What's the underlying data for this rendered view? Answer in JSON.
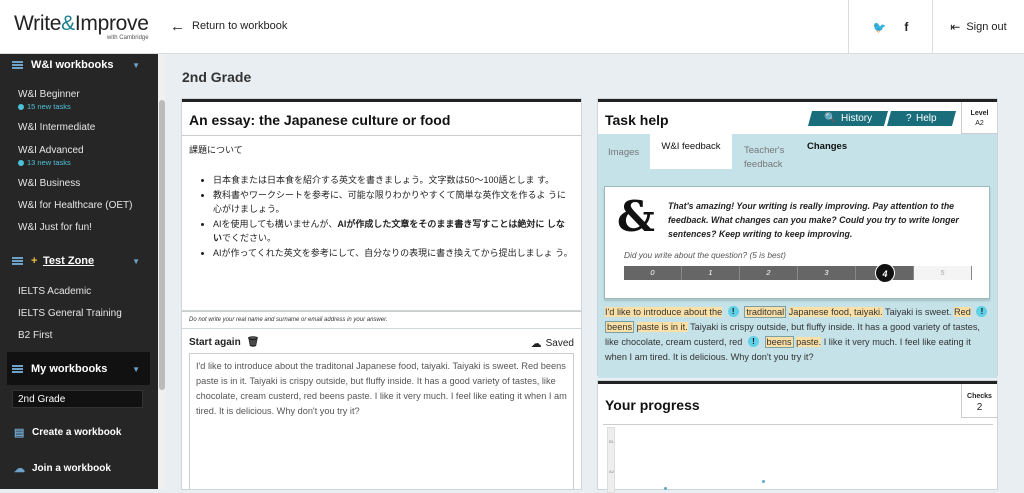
{
  "header": {
    "logo_main": "Write",
    "logo_amp": "&",
    "logo_end": "Improve",
    "logo_sub": "with Cambridge",
    "back_label": "Return to workbook",
    "twitter_icon": "twitter-icon",
    "facebook_icon": "facebook-icon",
    "twitter_glyph": "🐦",
    "facebook_glyph": "f",
    "sign_out": "Sign out"
  },
  "sidebar": {
    "wi_workbooks": "W&I workbooks",
    "items": [
      {
        "label": "W&I Beginner",
        "sub": "15 new tasks"
      },
      {
        "label": "W&I Intermediate"
      },
      {
        "label": "W&I Advanced",
        "sub": "13 new tasks"
      },
      {
        "label": "W&I Business"
      },
      {
        "label": "W&I for Healthcare (OET)"
      },
      {
        "label": "W&I Just for fun!"
      }
    ],
    "test_zone": "Test Zone",
    "test_items": [
      "IELTS Academic",
      "IELTS General Training",
      "B2 First"
    ],
    "my_workbooks": "My workbooks",
    "selected": "2nd Grade",
    "create": "Create a workbook",
    "join": "Join a workbook"
  },
  "main": {
    "title": "2nd Grade"
  },
  "essay": {
    "title": "An essay: the Japanese culture or food",
    "intro": "課題について",
    "bullets": [
      "日本食または日本食を紹介する英文を書きましょう。文字数は50〜100語としま す。",
      "教科書やワークシートを参考に、可能な限りわかりやすくて簡単な英作文を作るよ うに心がけましょう。",
      "AIが作ってくれた英文を参考にして、自分なりの表現に書き換えてから提出しましょ う。"
    ],
    "bullet_ai_pre": "AIを使用しても構いませんが、",
    "bullet_ai_bold": "AIが作成した文章をそのまま書き写すことは絶対に しない",
    "bullet_ai_post": "でください。",
    "privacy": "Do not write your real name and surname or email address in your answer.",
    "start_again": "Start again",
    "saved": "Saved",
    "answer": "I'd like to introduce about the traditonal Japanese food, taiyaki. Taiyaki is sweet. Red beens paste is in it. Taiyaki is crispy outside, but fluffy inside. It has a good variety of tastes, like chocolate, cream custerd, red beens paste. I like it very much. I feel like eating it when I am tired. It is delicious. Why don't you try it?"
  },
  "taskhelp": {
    "title": "Task help",
    "history": "History",
    "help": "Help",
    "level_label": "Level",
    "level_value": "A2",
    "tabs": [
      "Images",
      "W&I feedback",
      "Teacher's feedback",
      "Changes"
    ],
    "feedback_msg": "That's amazing! Your writing is really improving. Pay attention to the feedback. What changes can you make? Could you try to write longer sentences? Keep writing to keep improving.",
    "question": "Did you write about the question? (5 is best)",
    "scale": [
      "0",
      "1",
      "2",
      "3",
      "4",
      "5"
    ],
    "score": 4,
    "fb": {
      "s1": "I'd like to introduce about the",
      "w1": "traditonal",
      "s2": "Japanese food, taiyaki.",
      "s3": "Taiyaki is sweet.",
      "s4": "Red",
      "w2": "beens",
      "s5": "paste is in it.",
      "s6": "Taiyaki is crispy outside, but fluffy inside. It has a good variety of tastes, like chocolate, cream custerd, red",
      "w3": "beens",
      "s7": "paste.",
      "s8": "I like it very much. I feel like eating it when I am tired. It is delicious. Why don't you try it?",
      "bang": "!"
    }
  },
  "progress": {
    "title": "Your progress",
    "checks_label": "Checks",
    "checks_value": "2",
    "y_labels": [
      "B1",
      "A2"
    ]
  },
  "colors": {
    "accent": "#1a6e7c",
    "highlight": "#fbe0a6",
    "tab_bg": "#c4e2e8",
    "sidebar": "#262626"
  }
}
